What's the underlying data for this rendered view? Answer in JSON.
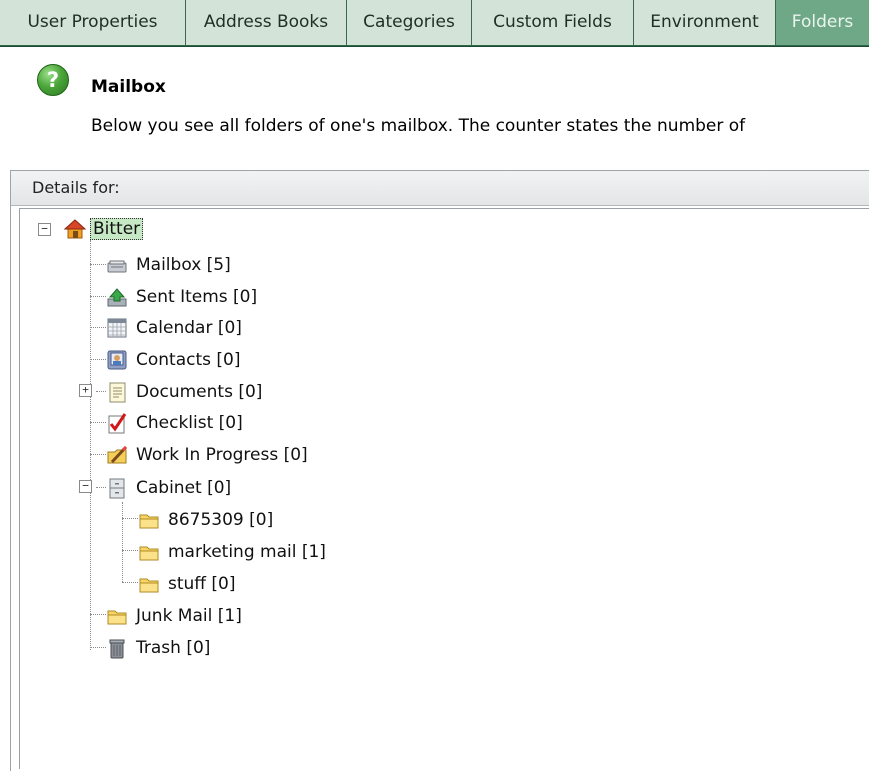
{
  "tabs": [
    {
      "label": "User Properties",
      "active": false
    },
    {
      "label": "Address Books",
      "active": false
    },
    {
      "label": "Categories",
      "active": false
    },
    {
      "label": "Custom Fields",
      "active": false
    },
    {
      "label": "Environment",
      "active": false
    },
    {
      "label": "Folders",
      "active": true
    }
  ],
  "info": {
    "icon": "help-question-icon",
    "title": "Mailbox",
    "description": "Below you see all folders of one's mailbox. The counter states the number of"
  },
  "panel": {
    "header": "Details for:"
  },
  "tree": {
    "root": {
      "label": "Bitter",
      "icon": "house-icon",
      "selected": true,
      "expanded": true
    },
    "items": [
      {
        "label": "Mailbox [5]",
        "icon": "mailbox-icon"
      },
      {
        "label": "Sent Items [0]",
        "icon": "sent-items-icon"
      },
      {
        "label": "Calendar [0]",
        "icon": "calendar-icon"
      },
      {
        "label": "Contacts [0]",
        "icon": "contacts-icon"
      },
      {
        "label": "Documents [0]",
        "icon": "documents-icon",
        "expanded": false
      },
      {
        "label": "Checklist [0]",
        "icon": "checklist-icon"
      },
      {
        "label": "Work In Progress [0]",
        "icon": "work-in-progress-icon"
      },
      {
        "label": "Cabinet [0]",
        "icon": "cabinet-icon",
        "expanded": true
      },
      {
        "label": "8675309 [0]",
        "icon": "folder-icon"
      },
      {
        "label": "marketing mail [1]",
        "icon": "folder-icon"
      },
      {
        "label": "stuff [0]",
        "icon": "folder-icon"
      },
      {
        "label": "Junk Mail [1]",
        "icon": "folder-icon"
      },
      {
        "label": "Trash [0]",
        "icon": "trash-icon"
      }
    ]
  },
  "colors": {
    "tab_bg": "#d3e3d7",
    "tab_active_bg": "#6fa887",
    "tab_border": "#2e6848",
    "selection": "#c6e8c4"
  }
}
